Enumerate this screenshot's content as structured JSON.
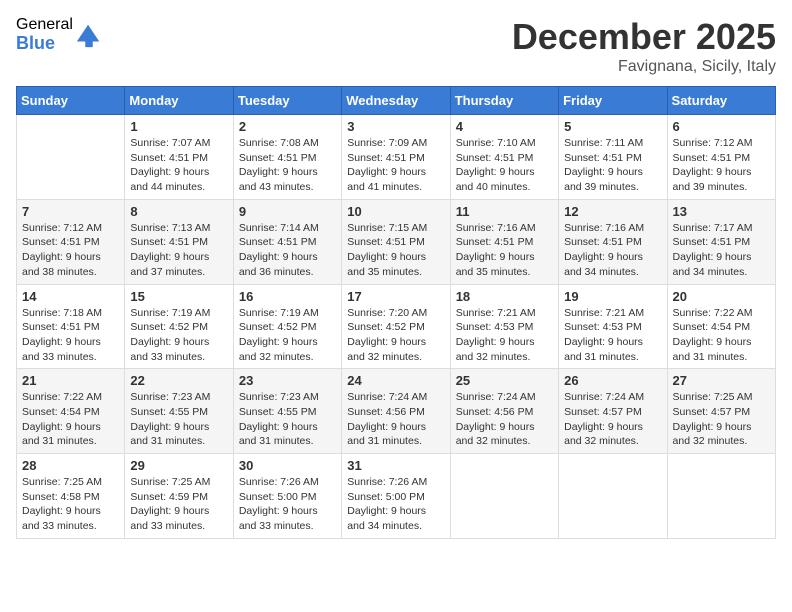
{
  "logo": {
    "general": "General",
    "blue": "Blue"
  },
  "title": "December 2025",
  "location": "Favignana, Sicily, Italy",
  "weekdays": [
    "Sunday",
    "Monday",
    "Tuesday",
    "Wednesday",
    "Thursday",
    "Friday",
    "Saturday"
  ],
  "weeks": [
    [
      {
        "day": "",
        "sunrise": "",
        "sunset": "",
        "daylight": ""
      },
      {
        "day": "1",
        "sunrise": "Sunrise: 7:07 AM",
        "sunset": "Sunset: 4:51 PM",
        "daylight": "Daylight: 9 hours and 44 minutes."
      },
      {
        "day": "2",
        "sunrise": "Sunrise: 7:08 AM",
        "sunset": "Sunset: 4:51 PM",
        "daylight": "Daylight: 9 hours and 43 minutes."
      },
      {
        "day": "3",
        "sunrise": "Sunrise: 7:09 AM",
        "sunset": "Sunset: 4:51 PM",
        "daylight": "Daylight: 9 hours and 41 minutes."
      },
      {
        "day": "4",
        "sunrise": "Sunrise: 7:10 AM",
        "sunset": "Sunset: 4:51 PM",
        "daylight": "Daylight: 9 hours and 40 minutes."
      },
      {
        "day": "5",
        "sunrise": "Sunrise: 7:11 AM",
        "sunset": "Sunset: 4:51 PM",
        "daylight": "Daylight: 9 hours and 39 minutes."
      },
      {
        "day": "6",
        "sunrise": "Sunrise: 7:12 AM",
        "sunset": "Sunset: 4:51 PM",
        "daylight": "Daylight: 9 hours and 39 minutes."
      }
    ],
    [
      {
        "day": "7",
        "sunrise": "Sunrise: 7:12 AM",
        "sunset": "Sunset: 4:51 PM",
        "daylight": "Daylight: 9 hours and 38 minutes."
      },
      {
        "day": "8",
        "sunrise": "Sunrise: 7:13 AM",
        "sunset": "Sunset: 4:51 PM",
        "daylight": "Daylight: 9 hours and 37 minutes."
      },
      {
        "day": "9",
        "sunrise": "Sunrise: 7:14 AM",
        "sunset": "Sunset: 4:51 PM",
        "daylight": "Daylight: 9 hours and 36 minutes."
      },
      {
        "day": "10",
        "sunrise": "Sunrise: 7:15 AM",
        "sunset": "Sunset: 4:51 PM",
        "daylight": "Daylight: 9 hours and 35 minutes."
      },
      {
        "day": "11",
        "sunrise": "Sunrise: 7:16 AM",
        "sunset": "Sunset: 4:51 PM",
        "daylight": "Daylight: 9 hours and 35 minutes."
      },
      {
        "day": "12",
        "sunrise": "Sunrise: 7:16 AM",
        "sunset": "Sunset: 4:51 PM",
        "daylight": "Daylight: 9 hours and 34 minutes."
      },
      {
        "day": "13",
        "sunrise": "Sunrise: 7:17 AM",
        "sunset": "Sunset: 4:51 PM",
        "daylight": "Daylight: 9 hours and 34 minutes."
      }
    ],
    [
      {
        "day": "14",
        "sunrise": "Sunrise: 7:18 AM",
        "sunset": "Sunset: 4:51 PM",
        "daylight": "Daylight: 9 hours and 33 minutes."
      },
      {
        "day": "15",
        "sunrise": "Sunrise: 7:19 AM",
        "sunset": "Sunset: 4:52 PM",
        "daylight": "Daylight: 9 hours and 33 minutes."
      },
      {
        "day": "16",
        "sunrise": "Sunrise: 7:19 AM",
        "sunset": "Sunset: 4:52 PM",
        "daylight": "Daylight: 9 hours and 32 minutes."
      },
      {
        "day": "17",
        "sunrise": "Sunrise: 7:20 AM",
        "sunset": "Sunset: 4:52 PM",
        "daylight": "Daylight: 9 hours and 32 minutes."
      },
      {
        "day": "18",
        "sunrise": "Sunrise: 7:21 AM",
        "sunset": "Sunset: 4:53 PM",
        "daylight": "Daylight: 9 hours and 32 minutes."
      },
      {
        "day": "19",
        "sunrise": "Sunrise: 7:21 AM",
        "sunset": "Sunset: 4:53 PM",
        "daylight": "Daylight: 9 hours and 31 minutes."
      },
      {
        "day": "20",
        "sunrise": "Sunrise: 7:22 AM",
        "sunset": "Sunset: 4:54 PM",
        "daylight": "Daylight: 9 hours and 31 minutes."
      }
    ],
    [
      {
        "day": "21",
        "sunrise": "Sunrise: 7:22 AM",
        "sunset": "Sunset: 4:54 PM",
        "daylight": "Daylight: 9 hours and 31 minutes."
      },
      {
        "day": "22",
        "sunrise": "Sunrise: 7:23 AM",
        "sunset": "Sunset: 4:55 PM",
        "daylight": "Daylight: 9 hours and 31 minutes."
      },
      {
        "day": "23",
        "sunrise": "Sunrise: 7:23 AM",
        "sunset": "Sunset: 4:55 PM",
        "daylight": "Daylight: 9 hours and 31 minutes."
      },
      {
        "day": "24",
        "sunrise": "Sunrise: 7:24 AM",
        "sunset": "Sunset: 4:56 PM",
        "daylight": "Daylight: 9 hours and 31 minutes."
      },
      {
        "day": "25",
        "sunrise": "Sunrise: 7:24 AM",
        "sunset": "Sunset: 4:56 PM",
        "daylight": "Daylight: 9 hours and 32 minutes."
      },
      {
        "day": "26",
        "sunrise": "Sunrise: 7:24 AM",
        "sunset": "Sunset: 4:57 PM",
        "daylight": "Daylight: 9 hours and 32 minutes."
      },
      {
        "day": "27",
        "sunrise": "Sunrise: 7:25 AM",
        "sunset": "Sunset: 4:57 PM",
        "daylight": "Daylight: 9 hours and 32 minutes."
      }
    ],
    [
      {
        "day": "28",
        "sunrise": "Sunrise: 7:25 AM",
        "sunset": "Sunset: 4:58 PM",
        "daylight": "Daylight: 9 hours and 33 minutes."
      },
      {
        "day": "29",
        "sunrise": "Sunrise: 7:25 AM",
        "sunset": "Sunset: 4:59 PM",
        "daylight": "Daylight: 9 hours and 33 minutes."
      },
      {
        "day": "30",
        "sunrise": "Sunrise: 7:26 AM",
        "sunset": "Sunset: 5:00 PM",
        "daylight": "Daylight: 9 hours and 33 minutes."
      },
      {
        "day": "31",
        "sunrise": "Sunrise: 7:26 AM",
        "sunset": "Sunset: 5:00 PM",
        "daylight": "Daylight: 9 hours and 34 minutes."
      },
      {
        "day": "",
        "sunrise": "",
        "sunset": "",
        "daylight": ""
      },
      {
        "day": "",
        "sunrise": "",
        "sunset": "",
        "daylight": ""
      },
      {
        "day": "",
        "sunrise": "",
        "sunset": "",
        "daylight": ""
      }
    ]
  ]
}
